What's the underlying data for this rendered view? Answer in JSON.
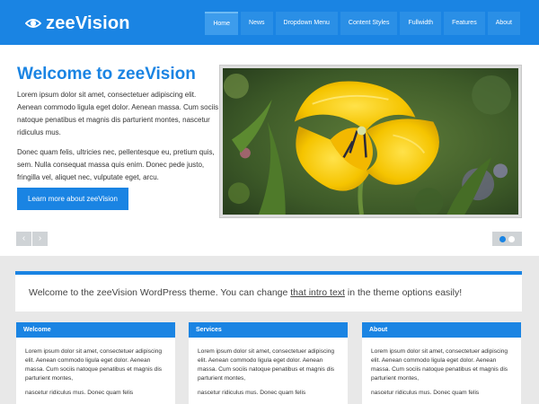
{
  "brand": {
    "logo_text": "zeeVision",
    "accent_color": "#1a84e3"
  },
  "nav": {
    "items": [
      {
        "label": "Home",
        "active": true
      },
      {
        "label": "News"
      },
      {
        "label": "Dropdown Menu"
      },
      {
        "label": "Content Styles"
      },
      {
        "label": "Fullwidth"
      },
      {
        "label": "Features"
      },
      {
        "label": "About"
      }
    ]
  },
  "slide": {
    "title": "Welcome to zeeVision",
    "paragraph1": "Lorem ipsum dolor sit amet, consectetuer adipiscing elit. Aenean commodo ligula eget dolor. Aenean massa. Cum sociis natoque penatibus et magnis dis parturient montes, nascetur ridiculus mus.",
    "paragraph2": "Donec quam felis, ultricies nec, pellentesque eu, pretium quis, sem. Nulla consequat massa quis enim. Donec pede justo, fringilla vel, aliquet nec, vulputate eget, arcu.",
    "button_label": "Learn more about zeeVision",
    "image_icon": "yellow-tulip-photo",
    "prev_icon": "‹",
    "next_icon": "›"
  },
  "intro": {
    "text_before": "Welcome to the zeeVision WordPress theme. You can change ",
    "link_text": "that intro text",
    "text_after": " in the theme options easily!"
  },
  "widgets": [
    {
      "title": "Welcome",
      "text": "Lorem ipsum dolor sit amet, consectetuer adipiscing elit. Aenean commodo ligula eget dolor. Aenean massa. Cum sociis natoque penatibus et magnis dis parturient montes,",
      "text2": "nascetur ridiculus mus. Donec quam felis"
    },
    {
      "title": "Services",
      "text": "Lorem ipsum dolor sit amet, consectetuer adipiscing elit. Aenean commodo ligula eget dolor. Aenean massa. Cum sociis natoque penatibus et magnis dis parturient montes,",
      "text2": "nascetur ridiculus mus. Donec quam felis"
    },
    {
      "title": "About",
      "text": "Lorem ipsum dolor sit amet, consectetuer adipiscing elit. Aenean commodo ligula eget dolor. Aenean massa. Cum sociis natoque penatibus et magnis dis parturient montes,",
      "text2": "nascetur ridiculus mus. Donec quam felis"
    }
  ]
}
